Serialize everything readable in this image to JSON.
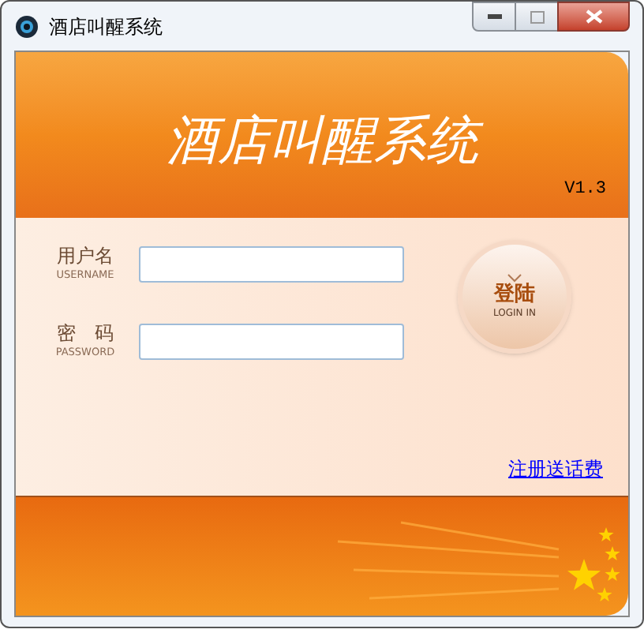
{
  "window": {
    "title": "酒店叫醒系统"
  },
  "banner": {
    "title": "酒店叫醒系统",
    "version": "V1.3"
  },
  "fields": [
    {
      "label": "用户名",
      "sublabel": "USERNAME"
    },
    {
      "label": "密　码",
      "sublabel": "PASSWORD"
    }
  ],
  "login_button": {
    "label": "登陆",
    "sublabel": "LOGIN IN"
  },
  "register_link": "注册送话费"
}
